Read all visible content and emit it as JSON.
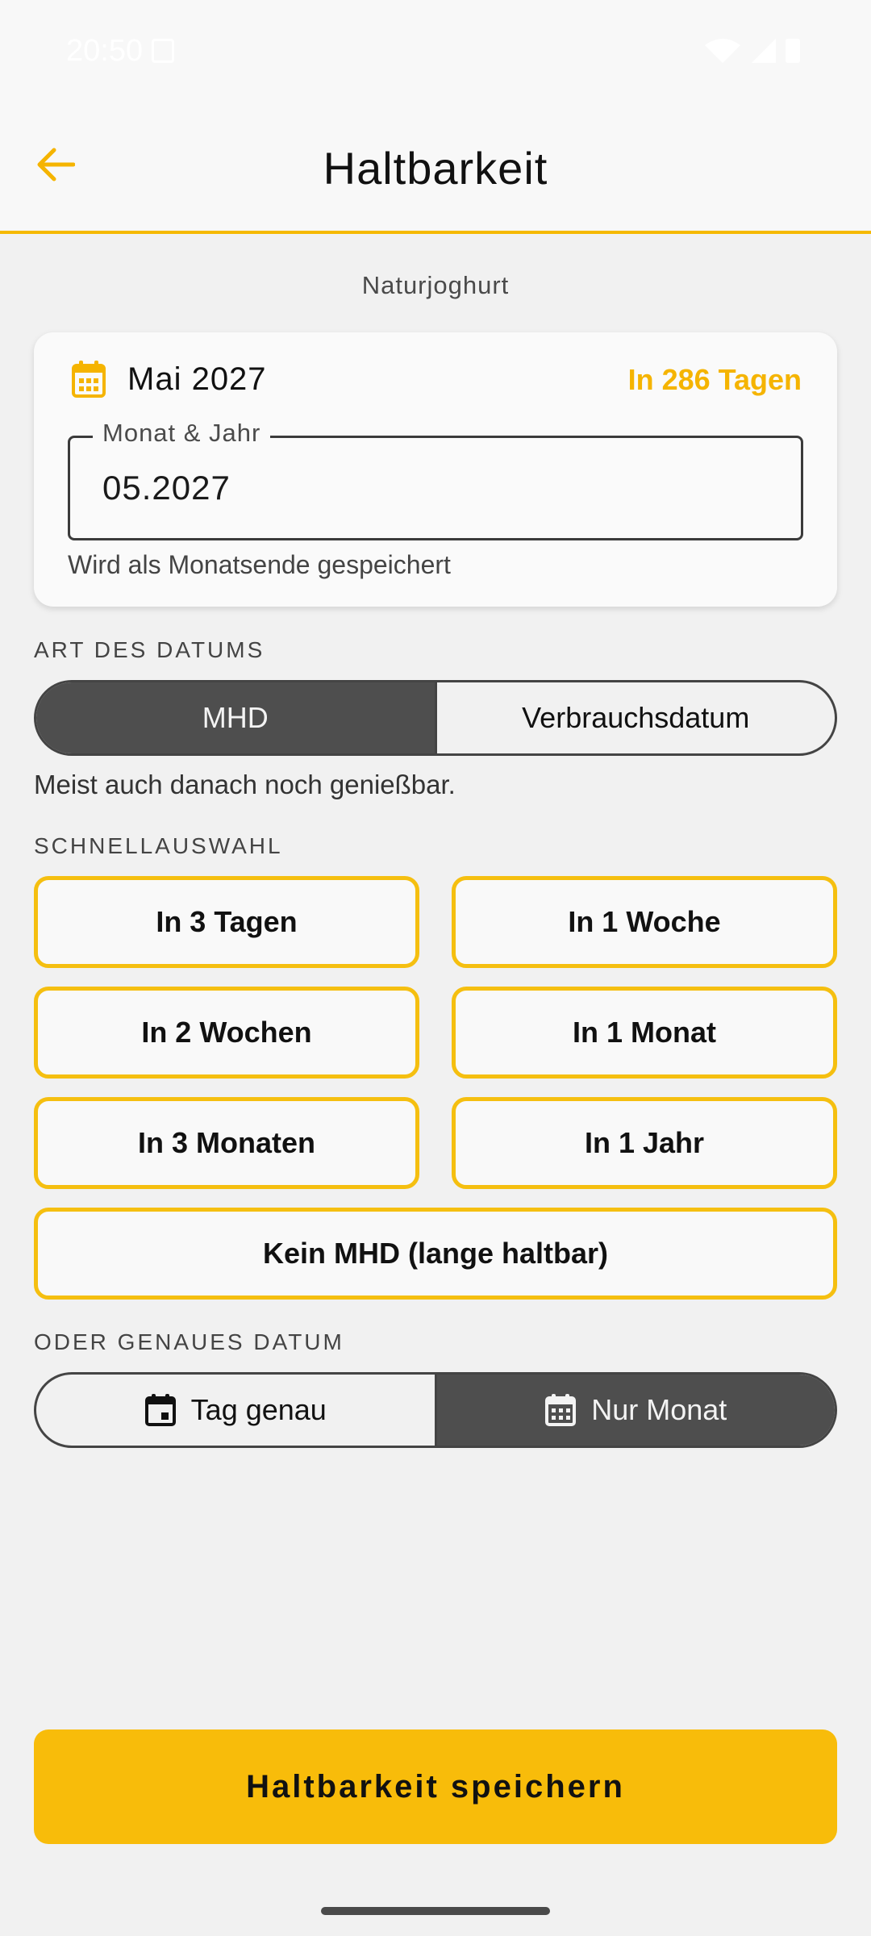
{
  "status_bar": {
    "time": "20:50"
  },
  "app_bar": {
    "title": "Haltbarkeit"
  },
  "product": {
    "name": "Naturjoghurt"
  },
  "date_card": {
    "date_label": "Mai 2027",
    "days_left": "In 286 Tagen",
    "field_label": "Monat & Jahr",
    "field_value": "05.2027",
    "helper": "Wird als Monatsende gespeichert"
  },
  "date_type": {
    "section_label": "ART DES DATUMS",
    "options": [
      "MHD",
      "Verbrauchsdatum"
    ],
    "selected": "MHD",
    "hint": "Meist auch danach noch genießbar."
  },
  "quick_select": {
    "section_label": "SCHNELLAUSWAHL",
    "options": [
      "In 3 Tagen",
      "In 1 Woche",
      "In 2 Wochen",
      "In 1 Monat",
      "In 3 Monaten",
      "In 1 Jahr"
    ],
    "no_expiry": "Kein MHD (lange haltbar)"
  },
  "exact_date": {
    "section_label": "ODER GENAUES DATUM",
    "options": [
      "Tag genau",
      "Nur Monat"
    ],
    "selected": "Nur Monat"
  },
  "save_button": {
    "label": "Haltbarkeit speichern"
  },
  "colors": {
    "accent": "#f5b900",
    "selected_segment": "#4e4e4e"
  }
}
